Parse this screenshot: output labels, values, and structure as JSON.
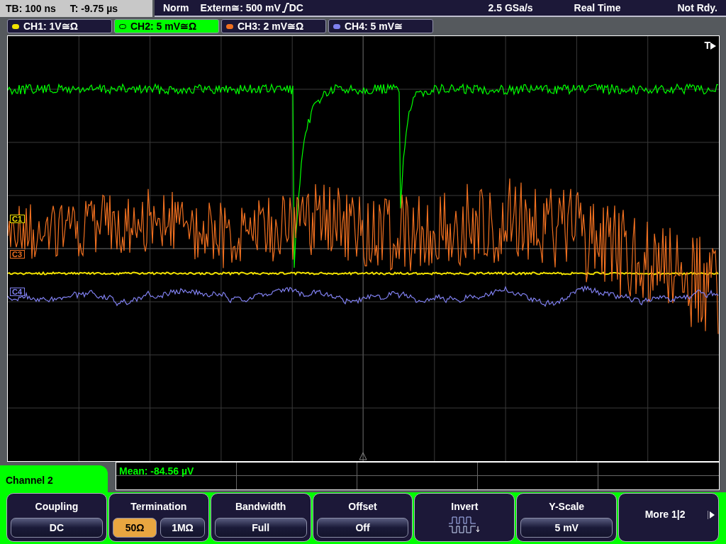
{
  "status_bar": {
    "timebase": "TB: 100 ns",
    "trigger_time": "T: -9.75 µs",
    "mode": "Norm",
    "trigger_source": "Extern≅: 500 mV",
    "trigger_coupling": "DC",
    "sample_rate": "2.5 GSa/s",
    "acquisition": "Real Time",
    "state": "Not Rdy."
  },
  "channels": [
    {
      "label": "CH1: 1V≅Ω",
      "color": "#f0e000",
      "selected": false
    },
    {
      "label": "CH2: 5 mV≅Ω",
      "color": "#00ff00",
      "selected": true
    },
    {
      "label": "CH3: 2 mV≅Ω",
      "color": "#f07020",
      "selected": false
    },
    {
      "label": "CH4: 5 mV≅",
      "color": "#8080f0",
      "selected": false
    }
  ],
  "plot": {
    "trigger_marker": "T",
    "markers": [
      {
        "label": "C1",
        "color": "#f0e000"
      },
      {
        "label": "C3",
        "color": "#f07020"
      },
      {
        "label": "C4",
        "color": "#8080f0"
      }
    ]
  },
  "measurement": {
    "text": "Mean: -84.56 µV"
  },
  "menu": {
    "title": "Channel 2",
    "softkeys": [
      {
        "kind": "value",
        "label": "Coupling",
        "value": "DC"
      },
      {
        "kind": "choice",
        "label": "Termination",
        "options": [
          {
            "label": "50Ω",
            "selected": true
          },
          {
            "label": "1MΩ",
            "selected": false
          }
        ]
      },
      {
        "kind": "value",
        "label": "Bandwidth",
        "value": "Full"
      },
      {
        "kind": "value",
        "label": "Offset",
        "value": "Off"
      },
      {
        "kind": "icon",
        "label": "Invert"
      },
      {
        "kind": "value",
        "label": "Y-Scale",
        "value": "5 mV"
      },
      {
        "kind": "more",
        "label": "More 1|2"
      }
    ]
  }
}
